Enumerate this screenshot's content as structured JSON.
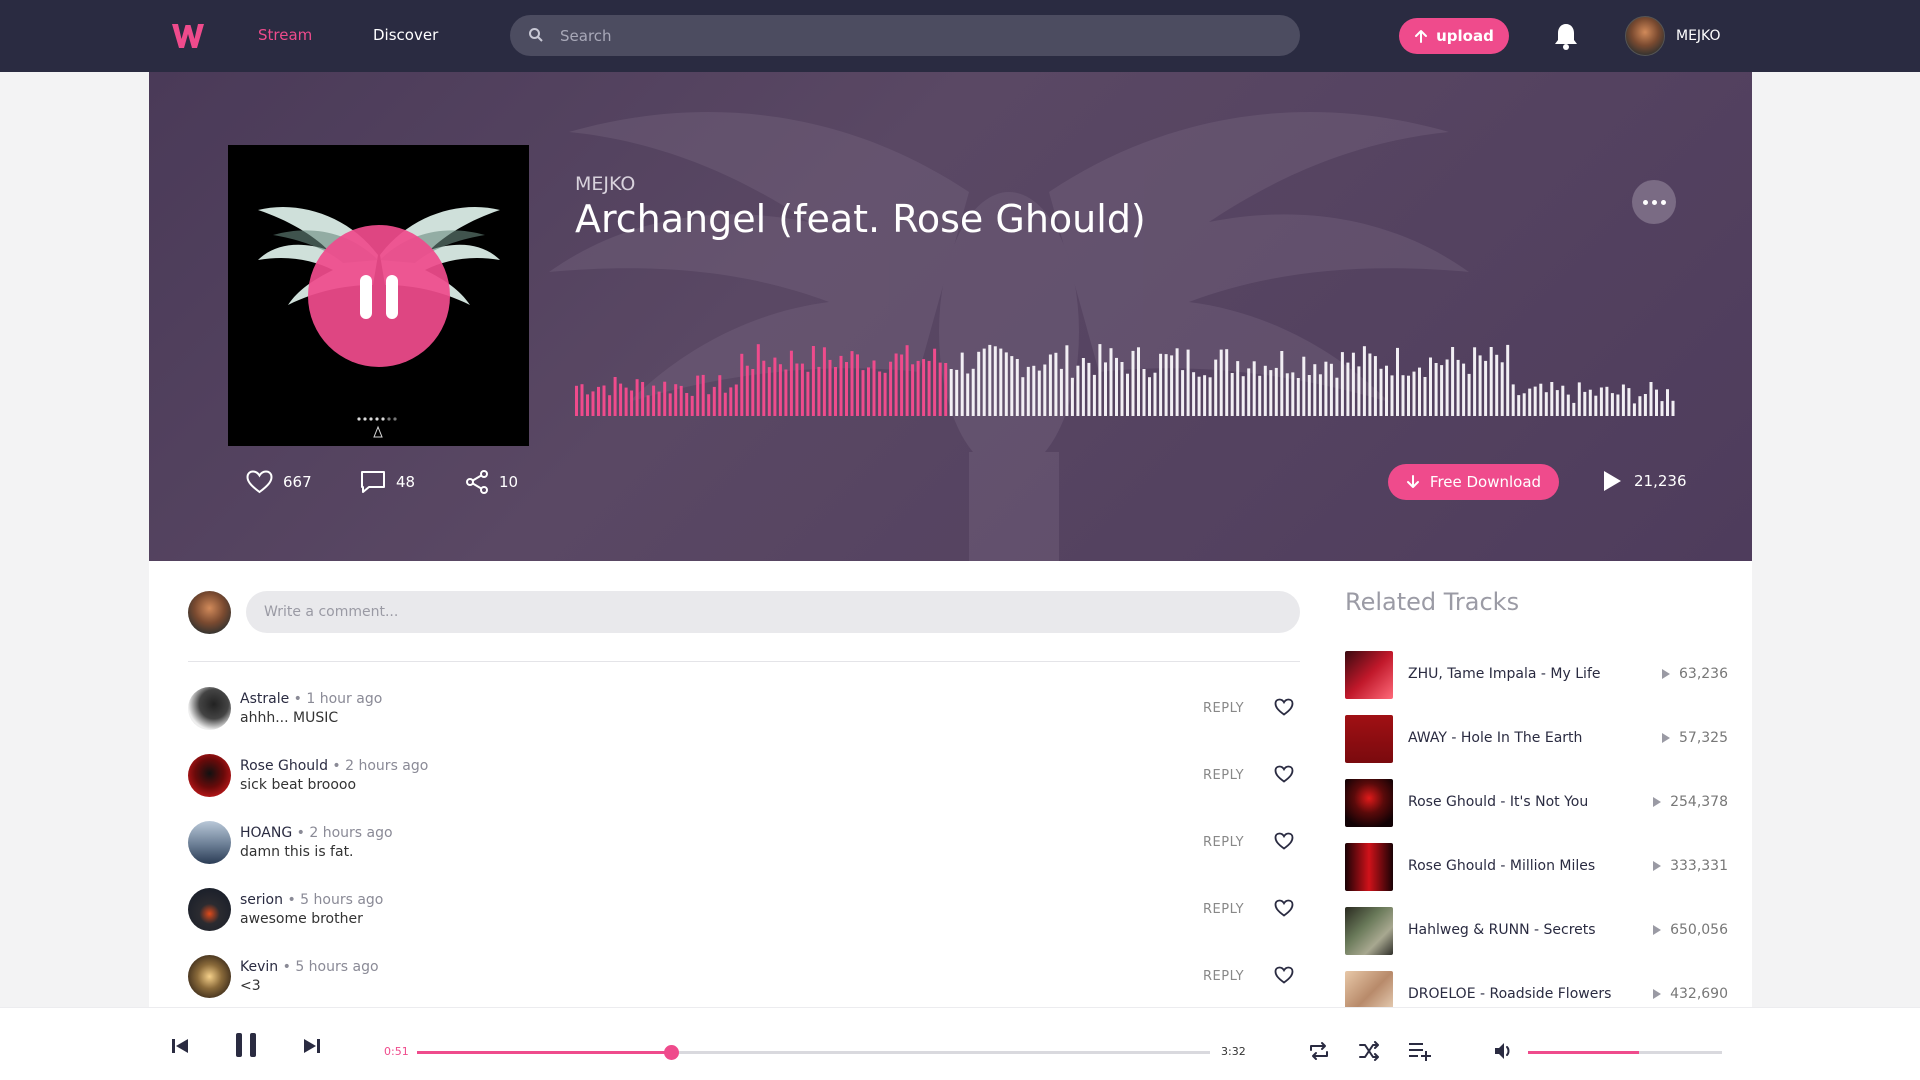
{
  "colors": {
    "accent": "#ef4b8c",
    "nav_bg": "#2a2b41"
  },
  "nav": {
    "logo": "W",
    "stream": "Stream",
    "discover": "Discover",
    "search_placeholder": "Search",
    "upload": "upload",
    "username": "MEJKO"
  },
  "track": {
    "artist": "MEJKO",
    "title": "Archangel (feat. Rose Ghould)",
    "likes": "667",
    "comments": "48",
    "shares": "10",
    "download": "Free Download",
    "plays": "21,236",
    "progress": 0.34,
    "cover_dots": "•••••"
  },
  "comment_box": {
    "placeholder": "Write a comment..."
  },
  "comments": [
    {
      "name": "Astrale",
      "time": "1 hour ago",
      "text": "ahhh... MUSIC",
      "reply": "REPLY"
    },
    {
      "name": "Rose Ghould",
      "time": "2 hours ago",
      "text": "sick beat broooo",
      "reply": "REPLY"
    },
    {
      "name": "HOANG",
      "time": "2 hours ago",
      "text": "damn this is fat.",
      "reply": "REPLY"
    },
    {
      "name": "serion",
      "time": "5 hours ago",
      "text": "awesome brother",
      "reply": "REPLY"
    },
    {
      "name": "Kevin",
      "time": "5 hours ago",
      "text": "<3",
      "reply": "REPLY"
    }
  ],
  "related": {
    "title": "Related Tracks",
    "items": [
      {
        "name": "ZHU, Tame Impala - My Life",
        "plays": "63,236"
      },
      {
        "name": "AWAY - Hole In The Earth",
        "plays": "57,325"
      },
      {
        "name": "Rose Ghould - It's Not You",
        "plays": "254,378"
      },
      {
        "name": "Rose Ghould - Million Miles",
        "plays": "333,331"
      },
      {
        "name": "Hahlweg & RUNN - Secrets",
        "plays": "650,056"
      },
      {
        "name": "DROELOE - Roadside Flowers",
        "plays": "432,690"
      }
    ]
  },
  "player": {
    "current_time": "0:51",
    "total_time": "3:32",
    "progress": 0.32,
    "volume": 0.57
  }
}
